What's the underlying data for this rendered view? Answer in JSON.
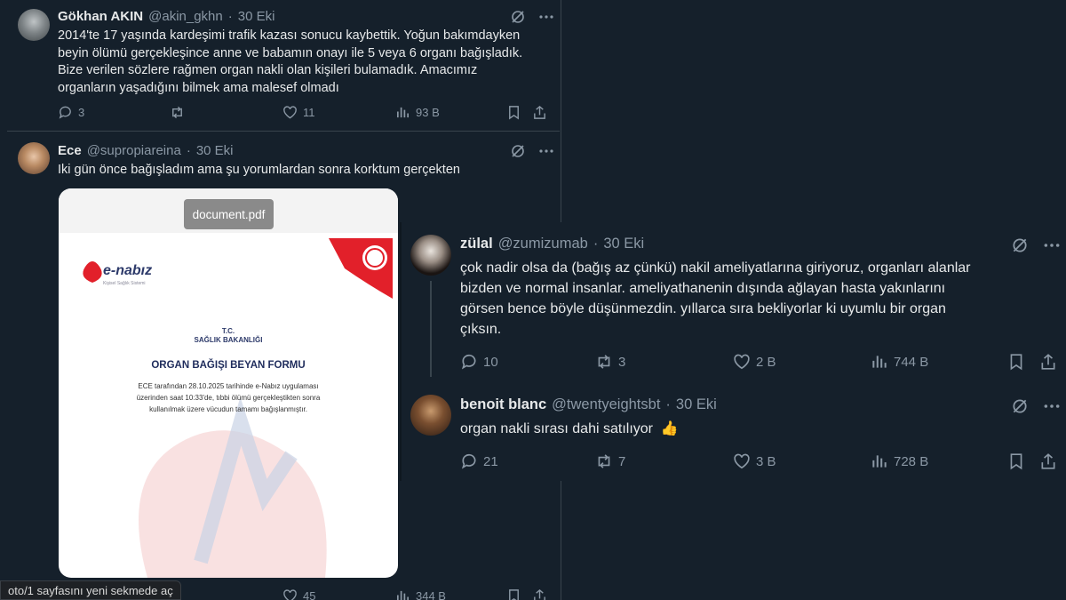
{
  "tweets": [
    {
      "name": "Gökhan AKIN",
      "handle": "@akin_gkhn",
      "dot": "·",
      "date": "30 Eki",
      "text_lines": [
        "2014'te 17 yaşında kardeşimi trafik kazası sonucu kaybettik. Yoğun bakımdayken",
        "beyin ölümü gerçekleşince anne ve babamın onayı ile 5 veya 6 organı bağışladık.",
        "Bize verilen sözlere rağmen organ nakli olan kişileri bulamadık. Amacımız",
        "organların yaşadığını bilmek ama malesef olmadı"
      ],
      "replies": "3",
      "reposts": "",
      "likes": "11",
      "views": "93 B"
    },
    {
      "name": "Ece",
      "handle": "@supropiareina",
      "dot": "·",
      "date": "30 Eki",
      "text": "Iki gün önce bağışladım ama şu yorumlardan sonra korktum gerçekten",
      "attachment": {
        "file_label": "document.pdf",
        "logo": "e-nabız",
        "logo_sub": "Kişisel Sağlık Sistemi",
        "doc_line1": "T.C.",
        "doc_line2": "SAĞLIK BAKANLIĞI",
        "doc_title": "ORGAN BAĞIŞI BEYAN FORMU",
        "doc_body_1": "ECE              tarafından 28.10.2025 tarihinde e-Nabız uygulaması",
        "doc_body_2": "üzerinden saat 10:33'de, tıbbi ölümü gerçekleştikten sonra",
        "doc_body_3": "kullanılmak üzere vücudun tamamı bağışlanmıştır."
      },
      "likes": "45",
      "views": "344 B"
    },
    {
      "name": "zülal",
      "handle": "@zumizumab",
      "dot": "·",
      "date": "30 Eki",
      "text_lines": [
        "çok nadir olsa da (bağış az çünkü) nakil ameliyatlarına giriyoruz, organları alanlar",
        "bizden ve normal insanlar. ameliyathanenin dışında ağlayan hasta yakınlarını",
        "görsen bence böyle düşünmezdin. yıllarca sıra bekliyorlar ki uyumlu bir organ",
        "çıksın."
      ],
      "replies": "10",
      "reposts": "3",
      "likes": "2 B",
      "views": "744 B"
    },
    {
      "name": "benoit blanc",
      "handle": "@twentyeightsbt",
      "dot": "·",
      "date": "30 Eki",
      "text": "organ nakli sırası dahi satılıyor",
      "emoji": "👍",
      "replies": "21",
      "reposts": "7",
      "likes": "3 B",
      "views": "728 B"
    }
  ],
  "statusbar": {
    "text": "oto/1 sayfasını yeni sekmede aç"
  },
  "colors": {
    "background": "#15202b",
    "text": "#e7e9ea",
    "muted": "#8b98a5",
    "border": "#38444d"
  }
}
